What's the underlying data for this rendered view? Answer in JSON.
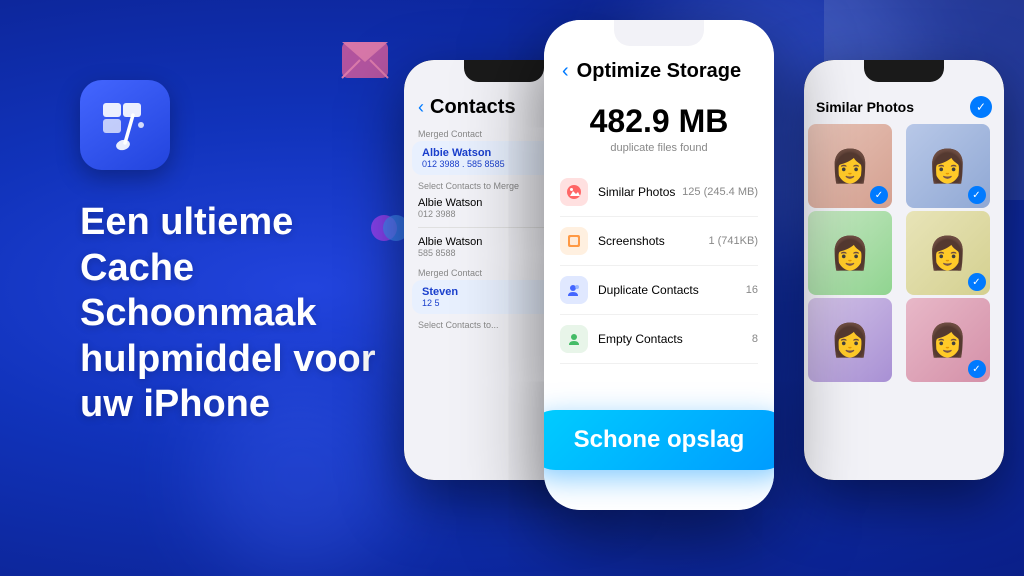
{
  "background": {
    "color": "#1a3fcc"
  },
  "appIcon": {
    "emoji": "🧹",
    "ariaLabel": "Cache Cleaner App Icon"
  },
  "heroText": {
    "line1": "Een ultieme",
    "line2": "Cache",
    "line3": "Schoonmaak",
    "line4": "hulpmiddel voor",
    "line5": "uw iPhone"
  },
  "phoneLeft": {
    "title": "Contacts",
    "backLabel": "‹",
    "mergedContactLabel1": "Merged Contact",
    "contact1Name": "Albie Watson",
    "contact1Phone": "012 3988 . 585 8585",
    "selectContactsLabel": "Select Contacts to Merge",
    "contact2Name": "Albie Watson",
    "contact2Phone": "012 3988",
    "contact3Name": "Albie Watson",
    "contact3Phone": "585 8588",
    "mergedContactLabel2": "Merged Contact",
    "contact4Name": "Steven",
    "contact4Phone": "12 5",
    "selectContacts2": "Select Contacts to..."
  },
  "phoneCenter": {
    "backLabel": "‹",
    "title": "Optimize Storage",
    "storageValue": "482.9 MB",
    "storageLabel": "duplicate files found",
    "items": [
      {
        "icon": "🖼️",
        "label": "Similar Photos",
        "count": "125 (245.4 MB)",
        "iconBg": "icon-photos"
      },
      {
        "icon": "📱",
        "label": "Screenshots",
        "count": "1 (741KB)",
        "iconBg": "icon-screenshots"
      },
      {
        "icon": "👤",
        "label": "Duplicate Contacts",
        "count": "16",
        "iconBg": "icon-contacts"
      },
      {
        "icon": "👤",
        "label": "Empty Contacts",
        "count": "8",
        "iconBg": "icon-empty"
      }
    ]
  },
  "phoneRight": {
    "title": "Similar Photos"
  },
  "ctaButton": {
    "label": "Schone opslag"
  }
}
